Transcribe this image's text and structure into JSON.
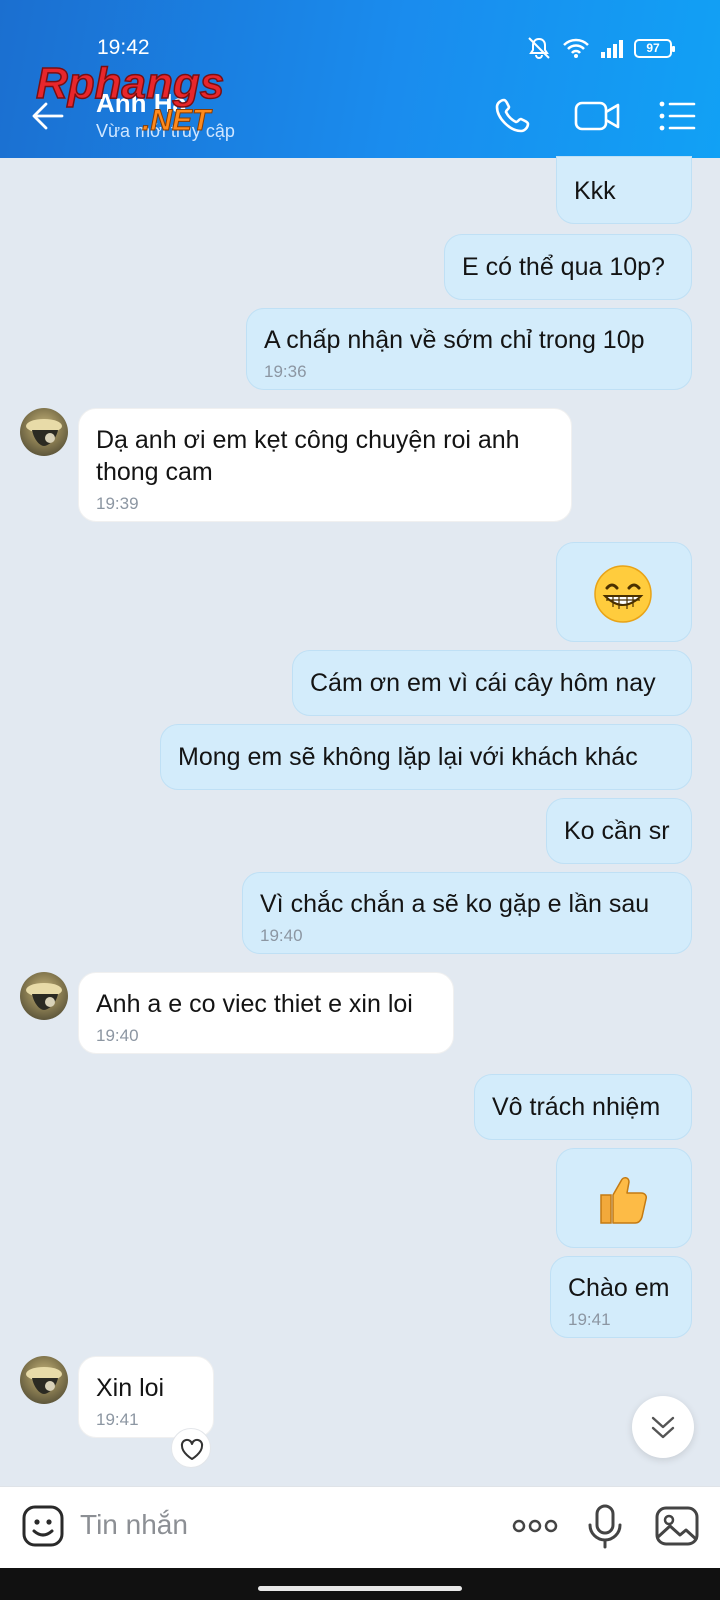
{
  "status": {
    "time": "19:42",
    "battery": "97"
  },
  "header": {
    "contact_name": "Anh Hà",
    "last_seen": "Vừa mới truy cập"
  },
  "watermark": {
    "line1": "Rphangs",
    "line2": ".NET"
  },
  "messages": [
    {
      "side": "me",
      "text": "Kkk"
    },
    {
      "side": "me",
      "text": "E có thể qua 10p?"
    },
    {
      "side": "me",
      "text": "A chấp nhận về sớm chỉ trong 10p",
      "time": "19:36"
    },
    {
      "side": "them",
      "text": "Dạ anh ơi em kẹt công chuyện roi anh thong cam",
      "time": "19:39"
    },
    {
      "side": "me",
      "emoji": "grinning-face"
    },
    {
      "side": "me",
      "text": "Cám ơn em vì cái cây hôm nay"
    },
    {
      "side": "me",
      "text": "Mong em sẽ không lặp lại với khách khác"
    },
    {
      "side": "me",
      "text": "Ko cần sr"
    },
    {
      "side": "me",
      "text": "Vì chắc chắn a sẽ ko gặp e lần sau",
      "time": "19:40"
    },
    {
      "side": "them",
      "text": "Anh a e co viec thiet e xin loi",
      "time": "19:40"
    },
    {
      "side": "me",
      "text": "Vô trách nhiệm"
    },
    {
      "side": "me",
      "emoji": "thumbs-up"
    },
    {
      "side": "me",
      "text": "Chào em",
      "time": "19:41"
    },
    {
      "side": "them",
      "text": "Xin loi",
      "time": "19:41"
    }
  ],
  "input": {
    "placeholder": "Tin nhắn"
  },
  "colors": {
    "header": "#1a8cee",
    "my_bubble": "#d3ecfb",
    "their_bubble": "#ffffff",
    "chat_bg": "#e2e9f1"
  }
}
